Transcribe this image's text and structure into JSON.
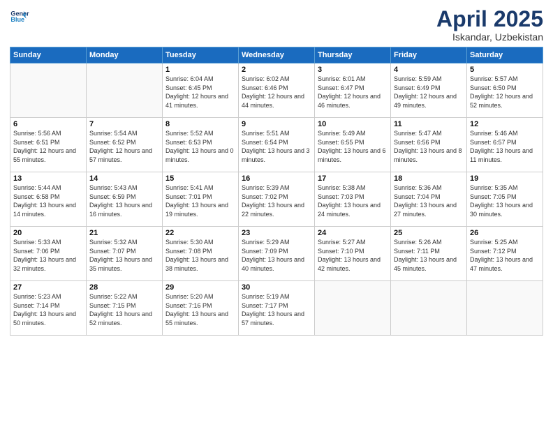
{
  "header": {
    "logo_line1": "General",
    "logo_line2": "Blue",
    "month_title": "April 2025",
    "location": "Iskandar, Uzbekistan"
  },
  "weekdays": [
    "Sunday",
    "Monday",
    "Tuesday",
    "Wednesday",
    "Thursday",
    "Friday",
    "Saturday"
  ],
  "weeks": [
    [
      {
        "day": "",
        "sunrise": "",
        "sunset": "",
        "daylight": ""
      },
      {
        "day": "",
        "sunrise": "",
        "sunset": "",
        "daylight": ""
      },
      {
        "day": "1",
        "sunrise": "Sunrise: 6:04 AM",
        "sunset": "Sunset: 6:45 PM",
        "daylight": "Daylight: 12 hours and 41 minutes."
      },
      {
        "day": "2",
        "sunrise": "Sunrise: 6:02 AM",
        "sunset": "Sunset: 6:46 PM",
        "daylight": "Daylight: 12 hours and 44 minutes."
      },
      {
        "day": "3",
        "sunrise": "Sunrise: 6:01 AM",
        "sunset": "Sunset: 6:47 PM",
        "daylight": "Daylight: 12 hours and 46 minutes."
      },
      {
        "day": "4",
        "sunrise": "Sunrise: 5:59 AM",
        "sunset": "Sunset: 6:49 PM",
        "daylight": "Daylight: 12 hours and 49 minutes."
      },
      {
        "day": "5",
        "sunrise": "Sunrise: 5:57 AM",
        "sunset": "Sunset: 6:50 PM",
        "daylight": "Daylight: 12 hours and 52 minutes."
      }
    ],
    [
      {
        "day": "6",
        "sunrise": "Sunrise: 5:56 AM",
        "sunset": "Sunset: 6:51 PM",
        "daylight": "Daylight: 12 hours and 55 minutes."
      },
      {
        "day": "7",
        "sunrise": "Sunrise: 5:54 AM",
        "sunset": "Sunset: 6:52 PM",
        "daylight": "Daylight: 12 hours and 57 minutes."
      },
      {
        "day": "8",
        "sunrise": "Sunrise: 5:52 AM",
        "sunset": "Sunset: 6:53 PM",
        "daylight": "Daylight: 13 hours and 0 minutes."
      },
      {
        "day": "9",
        "sunrise": "Sunrise: 5:51 AM",
        "sunset": "Sunset: 6:54 PM",
        "daylight": "Daylight: 13 hours and 3 minutes."
      },
      {
        "day": "10",
        "sunrise": "Sunrise: 5:49 AM",
        "sunset": "Sunset: 6:55 PM",
        "daylight": "Daylight: 13 hours and 6 minutes."
      },
      {
        "day": "11",
        "sunrise": "Sunrise: 5:47 AM",
        "sunset": "Sunset: 6:56 PM",
        "daylight": "Daylight: 13 hours and 8 minutes."
      },
      {
        "day": "12",
        "sunrise": "Sunrise: 5:46 AM",
        "sunset": "Sunset: 6:57 PM",
        "daylight": "Daylight: 13 hours and 11 minutes."
      }
    ],
    [
      {
        "day": "13",
        "sunrise": "Sunrise: 5:44 AM",
        "sunset": "Sunset: 6:58 PM",
        "daylight": "Daylight: 13 hours and 14 minutes."
      },
      {
        "day": "14",
        "sunrise": "Sunrise: 5:43 AM",
        "sunset": "Sunset: 6:59 PM",
        "daylight": "Daylight: 13 hours and 16 minutes."
      },
      {
        "day": "15",
        "sunrise": "Sunrise: 5:41 AM",
        "sunset": "Sunset: 7:01 PM",
        "daylight": "Daylight: 13 hours and 19 minutes."
      },
      {
        "day": "16",
        "sunrise": "Sunrise: 5:39 AM",
        "sunset": "Sunset: 7:02 PM",
        "daylight": "Daylight: 13 hours and 22 minutes."
      },
      {
        "day": "17",
        "sunrise": "Sunrise: 5:38 AM",
        "sunset": "Sunset: 7:03 PM",
        "daylight": "Daylight: 13 hours and 24 minutes."
      },
      {
        "day": "18",
        "sunrise": "Sunrise: 5:36 AM",
        "sunset": "Sunset: 7:04 PM",
        "daylight": "Daylight: 13 hours and 27 minutes."
      },
      {
        "day": "19",
        "sunrise": "Sunrise: 5:35 AM",
        "sunset": "Sunset: 7:05 PM",
        "daylight": "Daylight: 13 hours and 30 minutes."
      }
    ],
    [
      {
        "day": "20",
        "sunrise": "Sunrise: 5:33 AM",
        "sunset": "Sunset: 7:06 PM",
        "daylight": "Daylight: 13 hours and 32 minutes."
      },
      {
        "day": "21",
        "sunrise": "Sunrise: 5:32 AM",
        "sunset": "Sunset: 7:07 PM",
        "daylight": "Daylight: 13 hours and 35 minutes."
      },
      {
        "day": "22",
        "sunrise": "Sunrise: 5:30 AM",
        "sunset": "Sunset: 7:08 PM",
        "daylight": "Daylight: 13 hours and 38 minutes."
      },
      {
        "day": "23",
        "sunrise": "Sunrise: 5:29 AM",
        "sunset": "Sunset: 7:09 PM",
        "daylight": "Daylight: 13 hours and 40 minutes."
      },
      {
        "day": "24",
        "sunrise": "Sunrise: 5:27 AM",
        "sunset": "Sunset: 7:10 PM",
        "daylight": "Daylight: 13 hours and 42 minutes."
      },
      {
        "day": "25",
        "sunrise": "Sunrise: 5:26 AM",
        "sunset": "Sunset: 7:11 PM",
        "daylight": "Daylight: 13 hours and 45 minutes."
      },
      {
        "day": "26",
        "sunrise": "Sunrise: 5:25 AM",
        "sunset": "Sunset: 7:12 PM",
        "daylight": "Daylight: 13 hours and 47 minutes."
      }
    ],
    [
      {
        "day": "27",
        "sunrise": "Sunrise: 5:23 AM",
        "sunset": "Sunset: 7:14 PM",
        "daylight": "Daylight: 13 hours and 50 minutes."
      },
      {
        "day": "28",
        "sunrise": "Sunrise: 5:22 AM",
        "sunset": "Sunset: 7:15 PM",
        "daylight": "Daylight: 13 hours and 52 minutes."
      },
      {
        "day": "29",
        "sunrise": "Sunrise: 5:20 AM",
        "sunset": "Sunset: 7:16 PM",
        "daylight": "Daylight: 13 hours and 55 minutes."
      },
      {
        "day": "30",
        "sunrise": "Sunrise: 5:19 AM",
        "sunset": "Sunset: 7:17 PM",
        "daylight": "Daylight: 13 hours and 57 minutes."
      },
      {
        "day": "",
        "sunrise": "",
        "sunset": "",
        "daylight": ""
      },
      {
        "day": "",
        "sunrise": "",
        "sunset": "",
        "daylight": ""
      },
      {
        "day": "",
        "sunrise": "",
        "sunset": "",
        "daylight": ""
      }
    ]
  ]
}
